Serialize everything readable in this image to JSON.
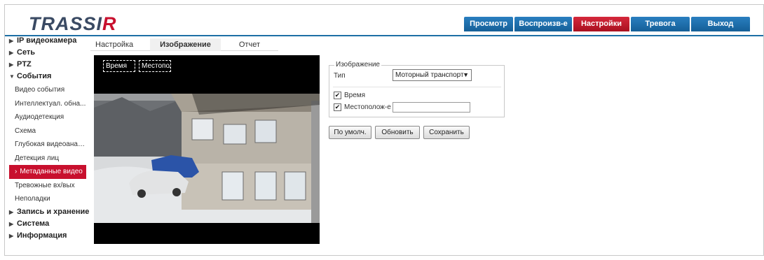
{
  "header": {
    "logo_text_main": "TRASSI",
    "logo_text_accent": "R",
    "nav": [
      {
        "label": "Просмотр"
      },
      {
        "label": "Воспроизв-е"
      },
      {
        "label": "Настройки"
      },
      {
        "label": "Тревога"
      },
      {
        "label": "Выход"
      }
    ],
    "active_nav": "Настройки"
  },
  "sidebar": {
    "items": [
      {
        "label": "IP видеокамера",
        "expanded": false
      },
      {
        "label": "Сеть",
        "expanded": false
      },
      {
        "label": "PTZ",
        "expanded": false
      },
      {
        "label": "События",
        "expanded": true
      },
      {
        "label": "Запись и хранение",
        "expanded": false
      },
      {
        "label": "Система",
        "expanded": false
      },
      {
        "label": "Информация",
        "expanded": false
      }
    ],
    "events_subitems": [
      {
        "label": "Видео события"
      },
      {
        "label": "Интеллектуал. обна..."
      },
      {
        "label": "Аудиодетекция"
      },
      {
        "label": "Схема"
      },
      {
        "label": "Глубокая видеоанал..."
      },
      {
        "label": "Детекция лиц"
      },
      {
        "label": "Метаданные видео"
      },
      {
        "label": "Тревожные вх/вых"
      },
      {
        "label": "Неполадки"
      }
    ],
    "active_subitem": "Метаданные видео"
  },
  "tabs": [
    {
      "label": "Настройка сцены"
    },
    {
      "label": "Изображение"
    },
    {
      "label": "Отчет"
    }
  ],
  "active_tab": "Изображение",
  "video": {
    "osd_time": "Время",
    "osd_location": "Местополс"
  },
  "form": {
    "legend": "Изображение",
    "type_label": "Тип",
    "type_value": "Моторный транспорт",
    "time_label": "Время",
    "time_checked": true,
    "location_label": "Местополож-е",
    "location_checked": true,
    "location_value": ""
  },
  "buttons": {
    "default": "По умолч.",
    "refresh": "Обновить",
    "save": "Сохранить"
  },
  "colors": {
    "nav_blue": "#1a6ba8",
    "nav_active_red": "#c8102e",
    "logo_dark": "#3a4a63"
  }
}
